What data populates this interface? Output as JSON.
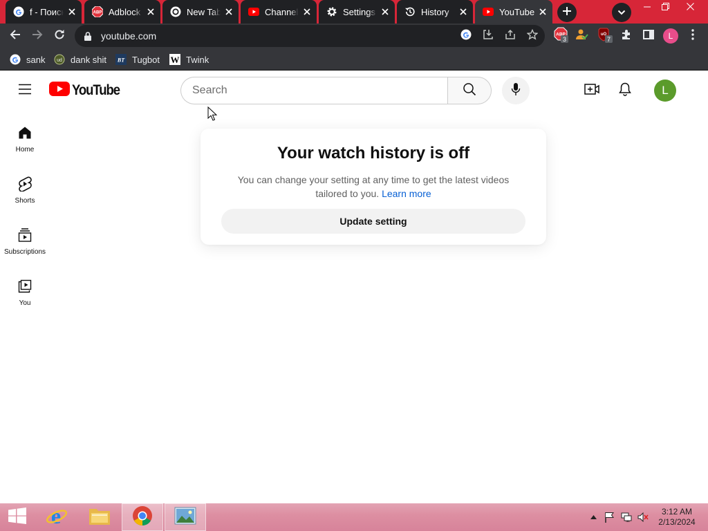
{
  "browser": {
    "tabs": [
      {
        "title": "f - Поиск",
        "icon": "google-icon"
      },
      {
        "title": "Adblock Plus",
        "icon": "adblock-icon"
      },
      {
        "title": "New Tab",
        "icon": "chrome-icon"
      },
      {
        "title": "Channel",
        "icon": "youtube-icon"
      },
      {
        "title": "Settings",
        "icon": "gear-icon"
      },
      {
        "title": "History",
        "icon": "history-icon"
      },
      {
        "title": "YouTube",
        "icon": "youtube-icon",
        "active": true
      }
    ],
    "address": "youtube.com",
    "extensions": {
      "adblock_badge": "3",
      "ublock_badge": "7"
    },
    "profile_initial": "L",
    "bookmarks": [
      {
        "label": "sank",
        "icon": "google-icon"
      },
      {
        "label": "dank shit",
        "icon": "globe-icon"
      },
      {
        "label": "Tugbot",
        "icon": "tugbot-icon"
      },
      {
        "label": "Twink",
        "icon": "w-icon"
      }
    ]
  },
  "youtube": {
    "logo_text": "YouTube",
    "search_placeholder": "Search",
    "avatar_initial": "L",
    "guide": [
      {
        "label": "Home",
        "icon": "home-icon"
      },
      {
        "label": "Shorts",
        "icon": "shorts-icon"
      },
      {
        "label": "Subscriptions",
        "icon": "subscriptions-icon"
      },
      {
        "label": "You",
        "icon": "you-icon"
      }
    ],
    "history_card": {
      "title": "Your watch history is off",
      "message": "You can change your setting at any time to get the latest videos tailored to you.",
      "link": "Learn more",
      "button": "Update setting"
    }
  },
  "taskbar": {
    "time": "3:12 AM",
    "date": "2/13/2024"
  },
  "colors": {
    "tab_strip": "#d72638",
    "toolbar": "#35363a",
    "yt_red": "#ff0000",
    "link_blue": "#065fd4",
    "avatar_green": "#5b9b2b"
  }
}
